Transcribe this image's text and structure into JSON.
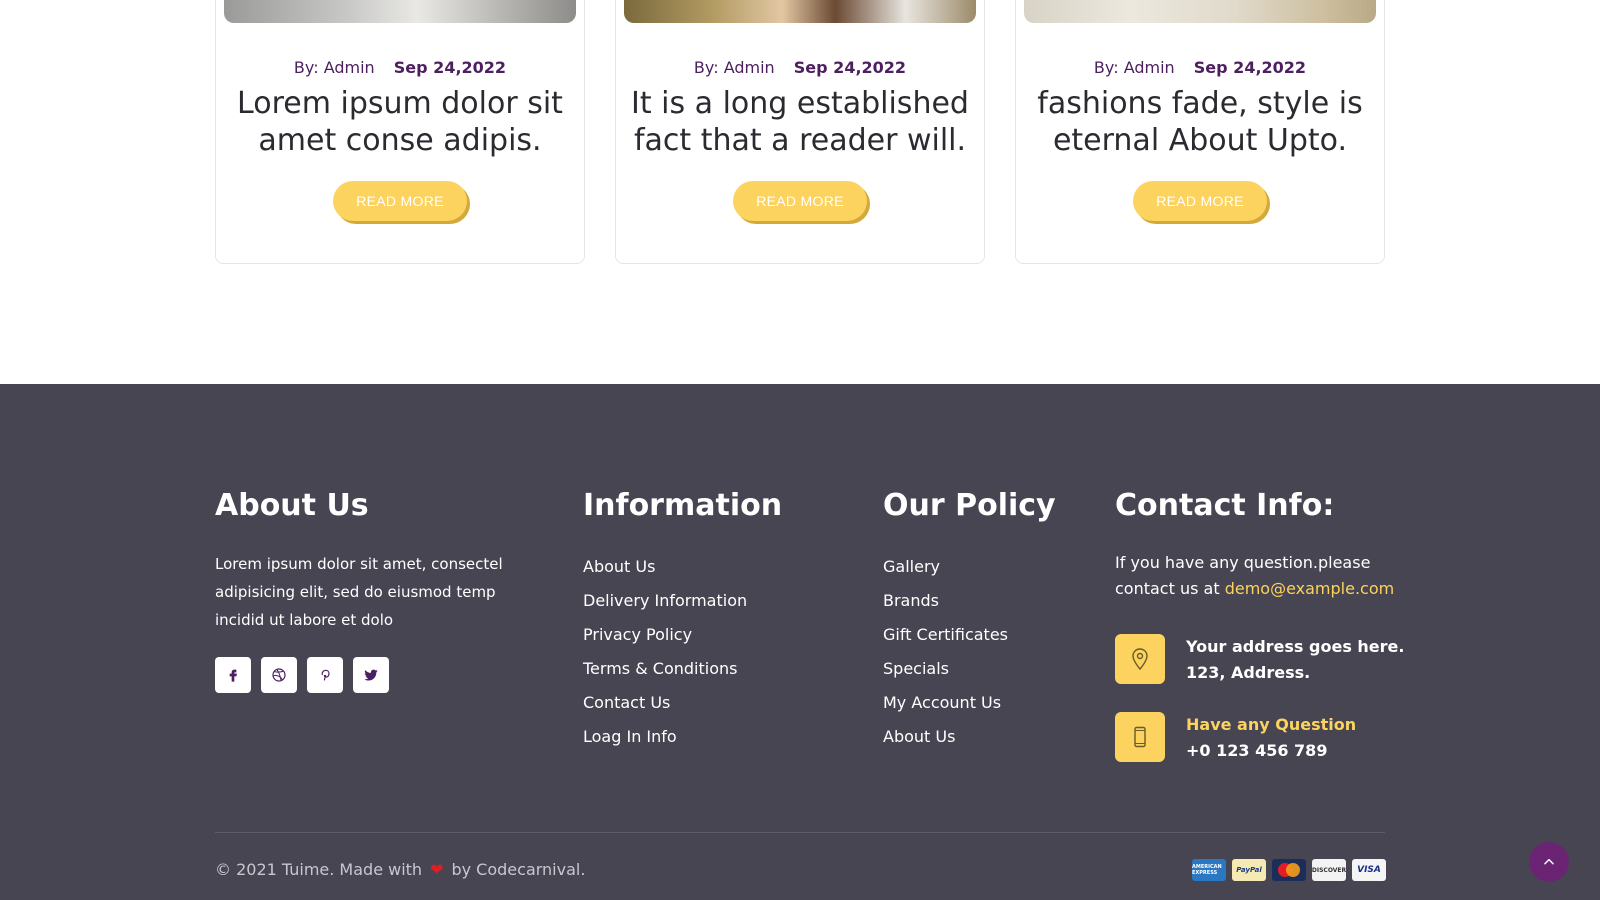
{
  "blog": {
    "posts": [
      {
        "by_label": "By:",
        "author": "Admin",
        "date": "Sep 24,2022",
        "title": "Lorem ipsum dolor sit amet conse adipis.",
        "button": "READ MORE"
      },
      {
        "by_label": "By:",
        "author": "Admin",
        "date": "Sep 24,2022",
        "title": "It is a long established fact that a reader will.",
        "button": "READ MORE"
      },
      {
        "by_label": "By:",
        "author": "Admin",
        "date": "Sep 24,2022",
        "title": "fashions fade, style is eternal About Upto.",
        "button": "READ MORE"
      }
    ]
  },
  "footer": {
    "about": {
      "title": "About Us",
      "text": "Lorem ipsum dolor sit amet, consectel adipisicing elit, sed do eiusmod temp incidid ut labore et dolo",
      "social": [
        "facebook-icon",
        "dribbble-icon",
        "pinterest-icon",
        "twitter-icon"
      ]
    },
    "information": {
      "title": "Information",
      "links": [
        "About Us",
        "Delivery Information",
        "Privacy Policy",
        "Terms & Conditions",
        "Contact Us",
        "Loag In Info"
      ]
    },
    "policy": {
      "title": "Our Policy",
      "links": [
        "Gallery",
        "Brands",
        "Gift Certificates",
        "Specials",
        "My Account Us",
        "About Us"
      ]
    },
    "contact": {
      "title": "Contact Info:",
      "text": "If you have any question.please contact us at",
      "email": "demo@example.com",
      "address_line1": "Your address goes here.",
      "address_line2": "123, Address.",
      "question_label": "Have any Question",
      "phone": "+0 123 456 789"
    },
    "copyright_prefix": "© 2021 Tuime. Made with",
    "copyright_suffix": "by Codecarnival.",
    "payments": [
      "AMERICAN EXPRESS",
      "PayPal",
      "MasterCard",
      "DISCOVER",
      "VISA"
    ]
  },
  "colors": {
    "accent": "#fbd35e",
    "footer_bg": "#474552",
    "meta_purple": "#4b1f60",
    "back_to_top": "#6a2473"
  }
}
